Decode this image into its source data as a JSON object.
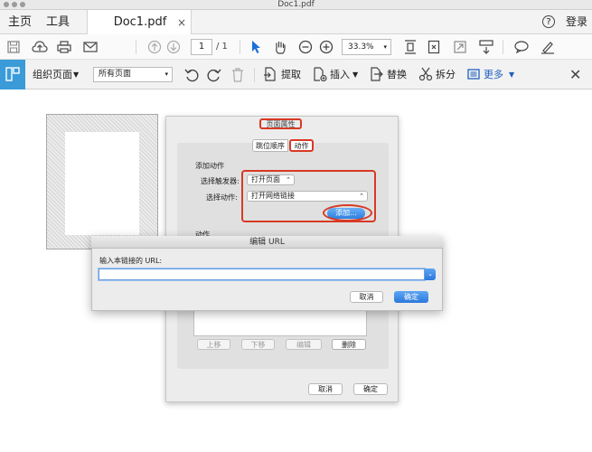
{
  "window": {
    "title": "Doc1.pdf"
  },
  "tabs": {
    "home": "主页",
    "tools": "工具",
    "doc": "Doc1.pdf",
    "close": "×"
  },
  "topright": {
    "help": "?",
    "login": "登录"
  },
  "toolbar1": {
    "page_value": "1",
    "page_total": "/ 1",
    "zoom": "33.3%"
  },
  "toolbar2": {
    "organize": "组织页面",
    "all_pages": "所有页面",
    "extract": "提取",
    "insert": "插入",
    "replace": "替换",
    "split": "拆分",
    "more": "更多"
  },
  "page_properties": {
    "title": "页面属性",
    "tab_order": "跳位顺序",
    "tab_action": "动作",
    "add_action": "添加动作",
    "trigger_label": "选择触发器:",
    "trigger_value": "打开页面",
    "action_label": "选择动作:",
    "action_value": "打开网络链接",
    "add_button": "添加...",
    "actions_section": "动作",
    "up": "上移",
    "down": "下移",
    "edit": "编辑",
    "delete": "删除",
    "cancel": "取消",
    "ok": "确定"
  },
  "edit_url": {
    "title": "编辑 URL",
    "prompt": "输入本链接的 URL:",
    "value": "",
    "cancel": "取消",
    "ok": "确定"
  },
  "colors": {
    "accent": "#3a9bd8",
    "highlight": "#d73a24",
    "primary_button": "#2c78dc"
  }
}
